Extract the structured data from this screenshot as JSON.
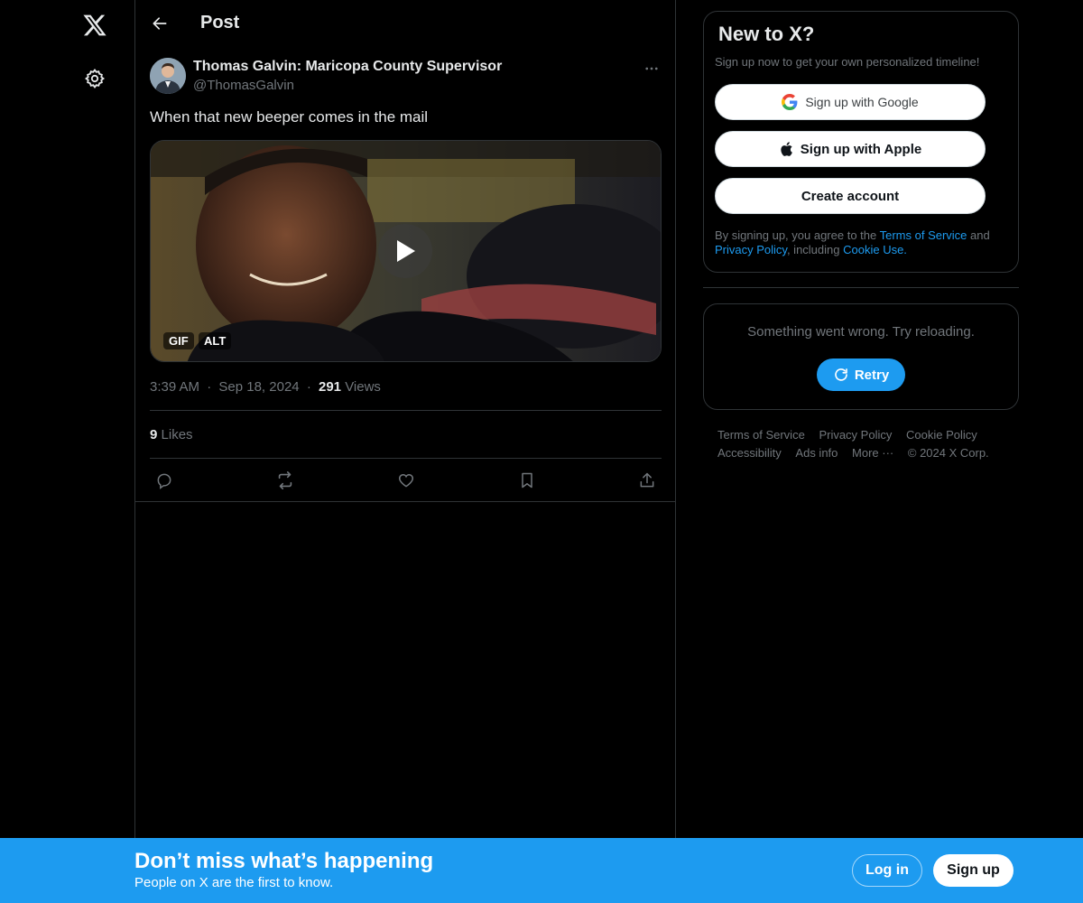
{
  "header": {
    "title": "Post"
  },
  "tweet": {
    "author_name": "Thomas Galvin: Maricopa County Supervisor",
    "author_handle": "@ThomasGalvin",
    "text": "When that new beeper comes in the mail",
    "media_badges": {
      "gif": "GIF",
      "alt": "ALT"
    },
    "time": "3:39 AM",
    "date": "Sep 18, 2024",
    "dot": "·",
    "views_count": "291",
    "views_label": "Views",
    "likes_count": "9",
    "likes_label": "Likes"
  },
  "signup": {
    "title": "New to X?",
    "subtitle": "Sign up now to get your own personalized timeline!",
    "google_label": "Sign up with Google",
    "apple_label": "Sign up with Apple",
    "create_label": "Create account",
    "terms_prefix": "By signing up, you agree to the ",
    "terms_link": "Terms of Service",
    "terms_and": " and ",
    "privacy_link": "Privacy Policy",
    "including": ", including ",
    "cookie_link": "Cookie Use."
  },
  "error": {
    "message": "Something went wrong. Try reloading.",
    "retry_label": "Retry"
  },
  "footer": {
    "terms": "Terms of Service",
    "privacy": "Privacy Policy",
    "cookie": "Cookie Policy",
    "accessibility": "Accessibility",
    "ads": "Ads info",
    "more": "More ···",
    "copyright": "© 2024 X Corp."
  },
  "bottom_bar": {
    "title": "Don’t miss what’s happening",
    "subtitle": "People on X are the first to know.",
    "login_label": "Log in",
    "signup_label": "Sign up"
  },
  "colors": {
    "accent": "#1d9bf0",
    "background": "#000000",
    "border": "#2f3336",
    "text_primary": "#e7e9ea",
    "text_secondary": "#71767b"
  },
  "icons": [
    "x-logo-icon",
    "gear-icon",
    "back-arrow-icon",
    "more-icon",
    "play-icon",
    "reply-icon",
    "repost-icon",
    "like-icon",
    "bookmark-icon",
    "share-icon",
    "google-icon",
    "apple-icon",
    "refresh-icon"
  ]
}
